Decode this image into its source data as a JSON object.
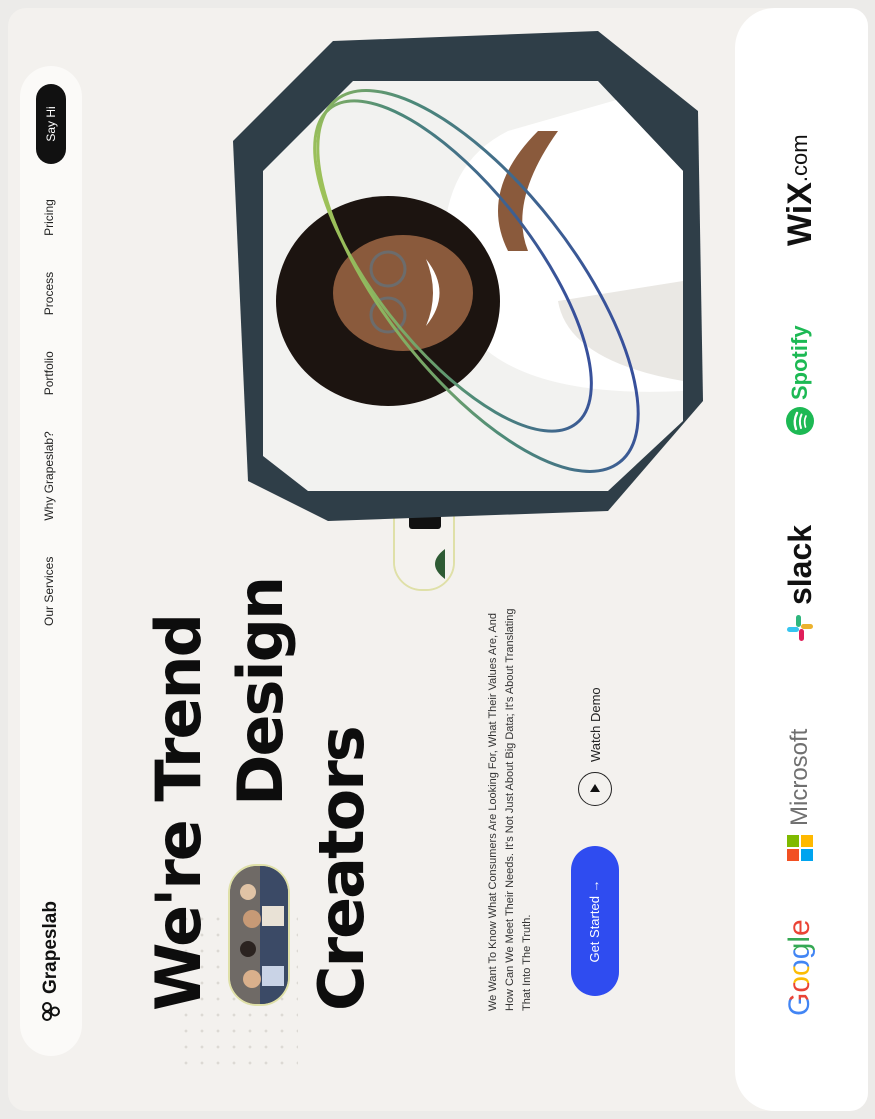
{
  "nav": {
    "logo": "Grapeslab",
    "links": [
      "Our Services",
      "Why Grapeslab?",
      "Portfolio",
      "Process",
      "Pricing"
    ],
    "cta": "Say Hi"
  },
  "hero": {
    "line1": "We're Trend",
    "line2": "Design",
    "line3": "Creators",
    "description": "We Want To Know What Consumers Are Looking For, What Their Values Are, And How Can We Meet Their Needs. It's Not Just About Big Data; It's About Translating That Into The Truth.",
    "primary_cta": "Get Started →",
    "secondary_cta": "Watch Demo"
  },
  "brands": {
    "google": "Google",
    "microsoft": "Microsoft",
    "slack": "slack",
    "spotify": "Spotify",
    "wix": "WiX",
    "wix_suffix": ".com"
  },
  "colors": {
    "accent": "#2f4cf0",
    "dark": "#111111",
    "background": "#f3f1ee",
    "spotify": "#1db954"
  },
  "icons": [
    "grapeslab-logo-icon",
    "arrow-right-icon",
    "play-icon",
    "microsoft-logo-icon",
    "slack-logo-icon",
    "spotify-logo-icon"
  ]
}
